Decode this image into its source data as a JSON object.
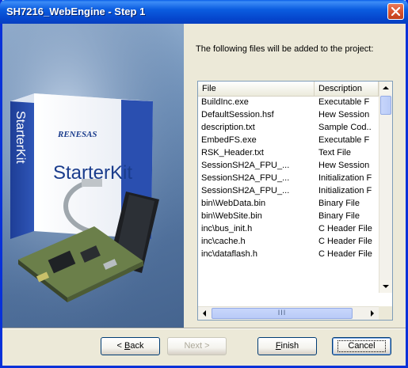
{
  "window": {
    "title": "SH7216_WebEngine - Step 1"
  },
  "art": {
    "brand": "RENESAS",
    "product": "StarterKit",
    "spine": "StarterKit"
  },
  "description": "The following files will be added to the project:",
  "list": {
    "columns": [
      "File",
      "Description"
    ],
    "rows": [
      {
        "file": "BuildInc.exe",
        "desc": "Executable F"
      },
      {
        "file": "DefaultSession.hsf",
        "desc": "Hew Session"
      },
      {
        "file": "description.txt",
        "desc": "Sample Cod.."
      },
      {
        "file": "EmbedFS.exe",
        "desc": "Executable F"
      },
      {
        "file": "RSK_Header.txt",
        "desc": "Text File"
      },
      {
        "file": "SessionSH2A_FPU_...",
        "desc": "Hew Session"
      },
      {
        "file": "SessionSH2A_FPU_...",
        "desc": "Initialization F"
      },
      {
        "file": "SessionSH2A_FPU_...",
        "desc": "Initialization F"
      },
      {
        "file": "bin\\WebData.bin",
        "desc": "Binary File"
      },
      {
        "file": "bin\\WebSite.bin",
        "desc": "Binary File"
      },
      {
        "file": "inc\\bus_init.h",
        "desc": "C Header File"
      },
      {
        "file": "inc\\cache.h",
        "desc": "C Header File"
      },
      {
        "file": "inc\\dataflash.h",
        "desc": "C Header File"
      }
    ],
    "hscroll_thumb": "III"
  },
  "buttons": {
    "back": {
      "label": "Back",
      "accel": "B",
      "prefix": "< "
    },
    "next": {
      "label": "Next >"
    },
    "finish": {
      "label": "Finish",
      "accel": "F"
    },
    "cancel": {
      "label": "Cancel"
    }
  },
  "colors": {
    "titlebar": "#0B5DE0",
    "face": "#ECE9D8",
    "brand_red": "#1A3C8C"
  }
}
